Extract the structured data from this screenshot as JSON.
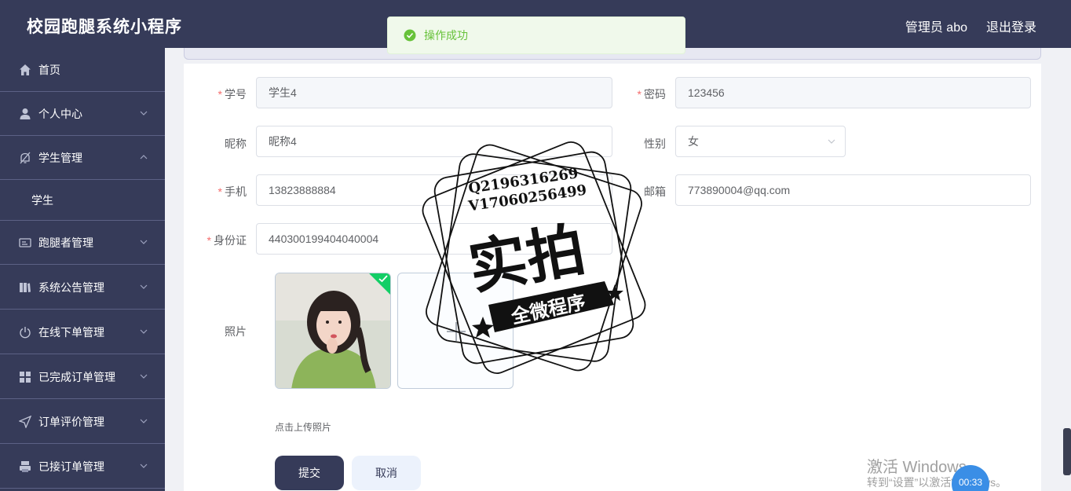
{
  "header": {
    "app_title": "校园跑腿系统小程序",
    "admin": "管理员 abo",
    "logout": "退出登录"
  },
  "sidebar": {
    "items": [
      {
        "label": "首页",
        "icon": "home-icon"
      },
      {
        "label": "个人中心",
        "icon": "user-icon"
      },
      {
        "label": "学生管理",
        "icon": "bell-off-icon"
      },
      {
        "label": "学生",
        "icon": ""
      },
      {
        "label": "跑腿者管理",
        "icon": "id-card-icon"
      },
      {
        "label": "系统公告管理",
        "icon": "book-icon"
      },
      {
        "label": "在线下单管理",
        "icon": "power-icon"
      },
      {
        "label": "已完成订单管理",
        "icon": "grid-icon"
      },
      {
        "label": "订单评价管理",
        "icon": "send-icon"
      },
      {
        "label": "已接订单管理",
        "icon": "printer-icon"
      }
    ]
  },
  "toast": {
    "message": "操作成功",
    "color": "#67c23a"
  },
  "form": {
    "student_id": {
      "label": "学号",
      "value": "学生4"
    },
    "password": {
      "label": "密码",
      "value": "123456"
    },
    "nickname": {
      "label": "昵称",
      "value": "昵称4"
    },
    "gender": {
      "label": "性别",
      "value": "女"
    },
    "phone": {
      "label": "手机",
      "value": "13823888884"
    },
    "email": {
      "label": "邮箱",
      "value": "773890004@qq.com"
    },
    "id_card": {
      "label": "身份证",
      "value": "440300199404040004"
    },
    "photo": {
      "label": "照片",
      "upload_hint": "点击上传照片"
    },
    "submit_label": "提交",
    "cancel_label": "取消"
  },
  "watermark": {
    "line1": "Q2196316269",
    "line2": "V17060256499",
    "main": "实拍",
    "banner": "全微程序"
  },
  "overlay": {
    "win_line1": "激活 Windows",
    "win_line2": "转到“设置”以激活Windows。",
    "timer": "00:33"
  },
  "colors": {
    "sidebar": "#363b59",
    "required": "#f56c6c",
    "primary_button": "#363b59"
  }
}
